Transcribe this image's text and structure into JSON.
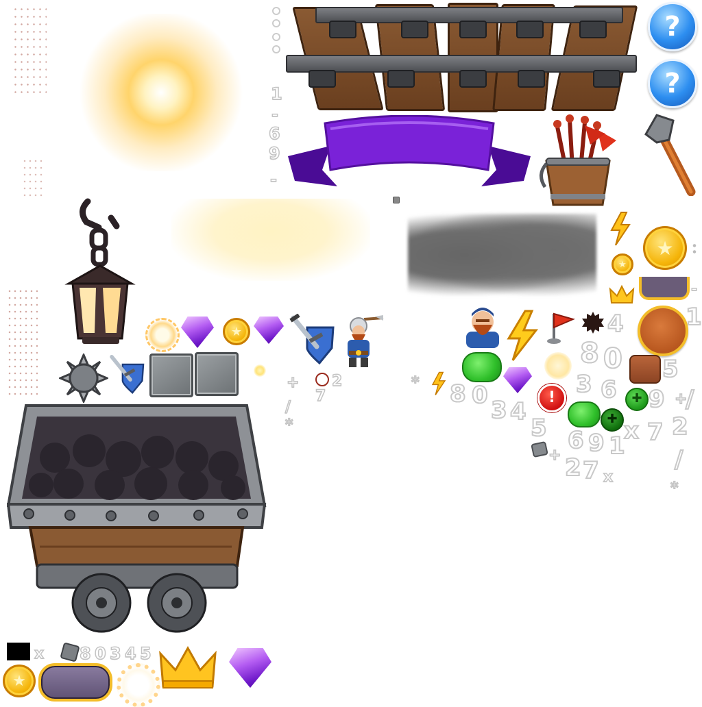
{
  "glyph_strips": {
    "vertical": [
      "1",
      "-",
      "6",
      "9",
      "-"
    ],
    "top": [
      "+",
      "2",
      "7",
      "/",
      "*"
    ],
    "right_col": [
      "4",
      "8",
      "0",
      "5",
      "3",
      "6",
      "9",
      "+",
      "/",
      "x",
      "7",
      "2",
      "/",
      "*"
    ],
    "middle": [
      "*",
      "8",
      "0",
      "3",
      "4",
      "5",
      "6",
      "9",
      "1",
      "+",
      "2",
      "7",
      "x"
    ],
    "bottom": [
      "x",
      "8",
      "0",
      "3",
      "4",
      "5"
    ]
  },
  "icons": [
    "sunburst-glow",
    "rail-track",
    "help-icon",
    "help-icon",
    "purple-ribbon-banner",
    "flag-bucket-icon",
    "pickaxe-icon",
    "lantern-icon",
    "soft-glow",
    "smoke-cloud",
    "lightning-icon",
    "coin-icon",
    "small-coin-icon",
    "crown-small-icon",
    "frame-tab",
    "dwarf-portrait",
    "lightning-big-icon",
    "flag-icon",
    "gear-dark-icon",
    "orange-round-button",
    "green-pill",
    "glow-circle",
    "brown-square-button",
    "alert-icon",
    "clover-green-icon",
    "gem-icon",
    "spiked-mace-icon",
    "sword-shield-icon",
    "stone-block",
    "dwarf-miner",
    "mine-cart",
    "black-swatch",
    "rock-small-icon",
    "crown-icon",
    "coin-large-icon",
    "purple-pill-frame",
    "explosion-ring"
  ],
  "colors": {
    "purple_ribbon": "#6a17c9",
    "coin_gold": "#f5b50a",
    "gem_purple": "#b45df2",
    "help_blue": "#1f7fe0",
    "green": "#2fbf2a",
    "orange": "#d9702a",
    "alert_red": "#e01515",
    "wood": "#7a4a26",
    "metal": "#5a5d62"
  }
}
